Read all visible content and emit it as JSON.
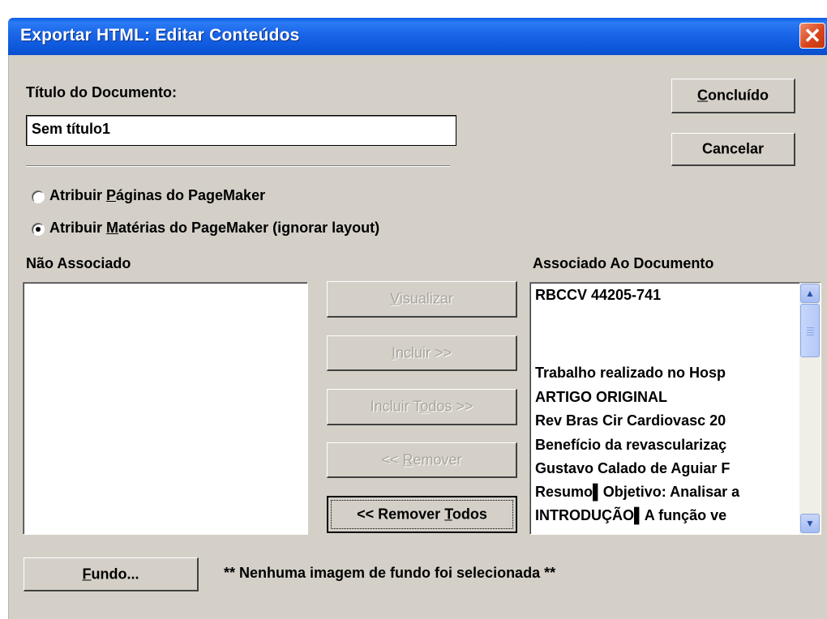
{
  "window": {
    "title": "Exportar HTML: Editar Conteúdos"
  },
  "document_title": {
    "label": "Título do Documento:",
    "value": "Sem título1"
  },
  "buttons": {
    "done": {
      "label_accel": "C",
      "label_rest": "oncluído"
    },
    "cancel": {
      "label": "Cancelar"
    },
    "view": {
      "label_accel": "V",
      "label_rest": "isualizar"
    },
    "include": {
      "label_accel": "I",
      "label_rest": "ncluir >>"
    },
    "include_all": {
      "label_pre": "Incluir T",
      "label_accel": "o",
      "label_rest": "dos >>"
    },
    "remove": {
      "label_pre": "<< ",
      "label_accel": "R",
      "label_rest": "emover"
    },
    "remove_all": {
      "label_pre": "<< Remover ",
      "label_accel": "T",
      "label_rest": "odos"
    },
    "background": {
      "label_accel": "F",
      "label_rest": "undo..."
    }
  },
  "options": [
    {
      "pre": "Atribuir ",
      "accel": "P",
      "rest": "áginas do PageMaker",
      "selected": false
    },
    {
      "pre": "Atribuir ",
      "accel": "M",
      "rest": "atérias do PageMaker (ignorar layout)",
      "selected": true
    }
  ],
  "unassociated": {
    "label": "Não Associado",
    "items": []
  },
  "associated": {
    "label": "Associado Ao Documento",
    "items": [
      "RBCCV 44205-741",
      "",
      "",
      "Trabalho realizado no Hosp",
      "ARTIGO ORIGINAL",
      "Rev Bras Cir Cardiovasc 20",
      "Benefício da revascularizaç",
      "Gustavo Calado de Aguiar F",
      "Resumo▌Objetivo: Analisar a",
      "INTRODUÇÃO▌A função ve"
    ]
  },
  "background_status": "** Nenhuma imagem de fundo foi selecionada **"
}
